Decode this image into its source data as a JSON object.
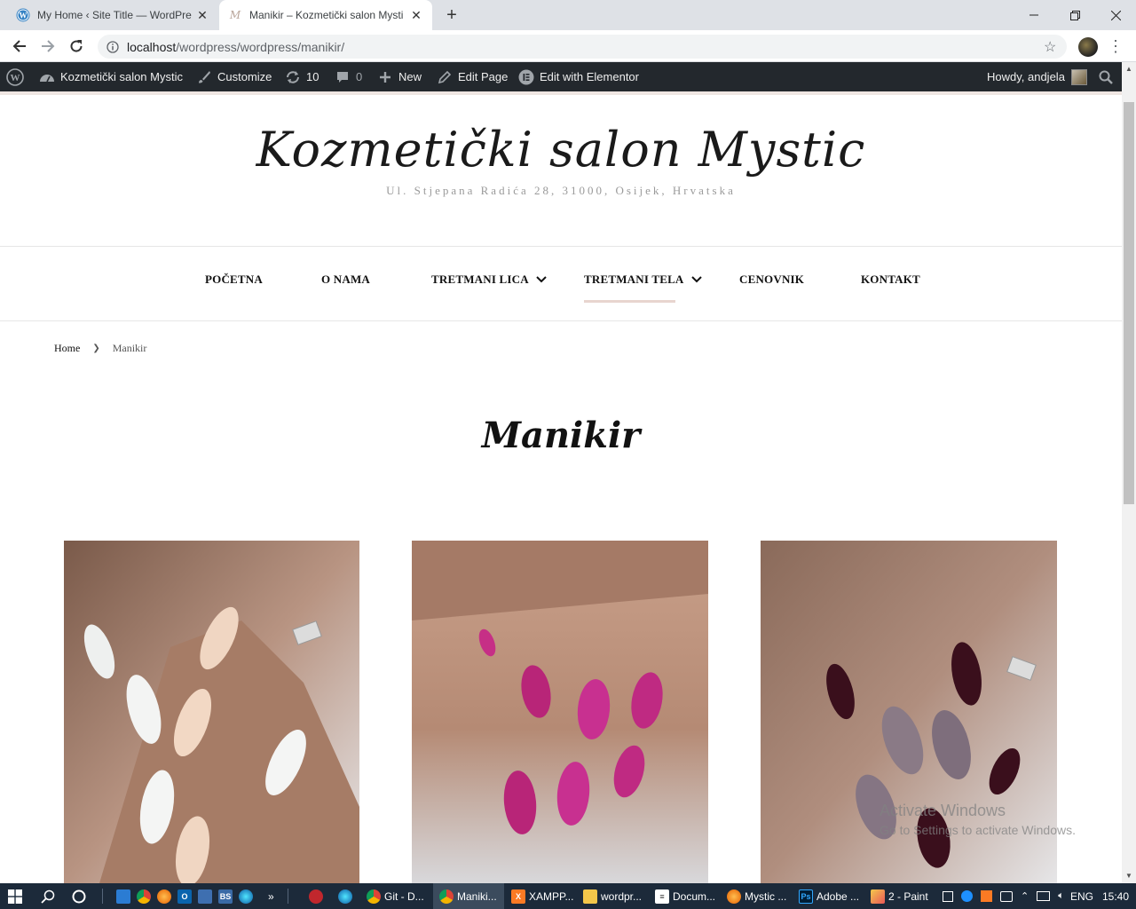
{
  "browser": {
    "tabs": [
      {
        "title": "My Home ‹ Site Title — WordPre",
        "active": false
      },
      {
        "title": "Manikir – Kozmetički salon Mysti",
        "active": true
      }
    ],
    "url_host": "localhost",
    "url_path": "/wordpress/wordpress/manikir/"
  },
  "adminbar": {
    "site_name": "Kozmetički salon Mystic",
    "customize": "Customize",
    "updates_count": "10",
    "comments_count": "0",
    "new_label": "New",
    "edit_page": "Edit Page",
    "edit_elementor": "Edit with Elementor",
    "howdy": "Howdy, andjela"
  },
  "site": {
    "title": "Kozmetički salon Mystic",
    "description": "Ul. Stjepana Radića 28, 31000, Osijek, Hrvatska"
  },
  "menu": {
    "items": [
      {
        "label": "POČETNA",
        "has_dropdown": false
      },
      {
        "label": "O NAMA",
        "has_dropdown": false
      },
      {
        "label": "TRETMANI LICA",
        "has_dropdown": true
      },
      {
        "label": "TRETMANI TELA",
        "has_dropdown": true,
        "current": true
      },
      {
        "label": "CENOVNIK",
        "has_dropdown": false
      },
      {
        "label": "KONTAKT",
        "has_dropdown": false
      }
    ]
  },
  "breadcrumb": {
    "home": "Home",
    "current": "Manikir"
  },
  "page": {
    "title": "Manikir"
  },
  "watermark": {
    "line1": "Activate Windows",
    "line2": "Go to Settings to activate Windows."
  },
  "taskbar": {
    "items": [
      {
        "label": "Git - D...",
        "icon": "chrome-icon"
      },
      {
        "label": "Maniki...",
        "icon": "chrome-icon",
        "active": true
      },
      {
        "label": "XAMPP...",
        "icon": "xampp-icon"
      },
      {
        "label": "wordpr...",
        "icon": "folder-icon"
      },
      {
        "label": "Docum...",
        "icon": "document-icon"
      },
      {
        "label": "Mystic ...",
        "icon": "firefox-icon"
      },
      {
        "label": "Adobe ...",
        "icon": "photoshop-icon"
      },
      {
        "label": "2 - Paint",
        "icon": "paint-icon"
      }
    ],
    "lang": "ENG",
    "time": "15:40"
  },
  "colors": {
    "adminbar_bg": "#23282d",
    "menu_active_underline": "#e8d5cf",
    "taskbar_bg": "#1c2a3a"
  }
}
